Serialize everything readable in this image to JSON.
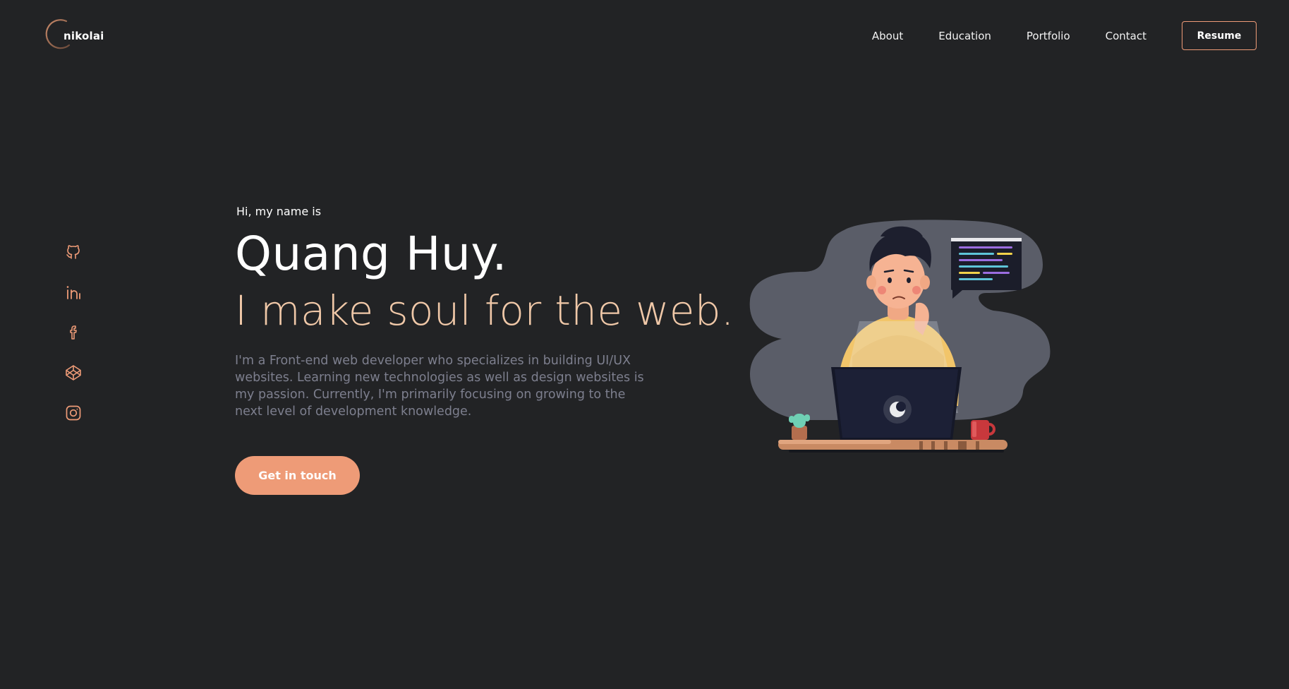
{
  "header": {
    "logo_text": "nikolai",
    "nav": [
      "About",
      "Education",
      "Portfolio",
      "Contact"
    ],
    "resume_label": "Resume"
  },
  "social": [
    {
      "icon": "github-icon"
    },
    {
      "icon": "linkedin-icon"
    },
    {
      "icon": "facebook-icon"
    },
    {
      "icon": "codepen-icon"
    },
    {
      "icon": "instagram-icon"
    }
  ],
  "hero": {
    "greeting": "Hi, my name is",
    "name": "Quang Huy.",
    "tagline": "I make soul for the web.",
    "description": "I'm a Front-end web developer who specializes in building UI/UX websites. Learning new technologies as well as design websites is my passion. Currently, I'm primarily focusing on growing to the next level of development knowledge.",
    "cta_label": "Get in touch"
  },
  "colors": {
    "background": "#222325",
    "accent": "#ee9b77",
    "tagline": "#f0c8a8",
    "muted_text": "#7d7f8e",
    "blob": "#5a5d68"
  }
}
